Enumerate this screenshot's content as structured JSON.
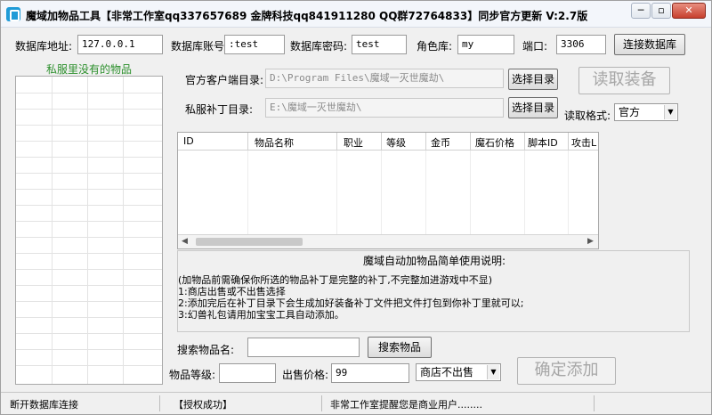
{
  "window": {
    "title": "魔域加物品工具【非常工作室qq337657689 金牌科技qq841911280 QQ群72764833】同步官方更新 V:2.7版",
    "minimize_glyph": "─",
    "restore_glyph": "▫",
    "close_glyph": "✕"
  },
  "db": {
    "addr_label": "数据库地址:",
    "addr_value": "127.0.0.1",
    "user_label": "数据库账号",
    "user_value": ":test",
    "pass_label": "数据库密码:",
    "pass_value": "test",
    "role_label": "角色库:",
    "role_value": "my",
    "port_label": "端口:",
    "port_value": "3306",
    "connect_button": "连接数据库"
  },
  "left_panel": {
    "title": "私服里没有的物品"
  },
  "dirs": {
    "official_label": "官方客户端目录:",
    "official_path": "D:\\Program Files\\魔域一灭世魔劫\\",
    "official_button": "选择目录",
    "private_label": "私服补丁目录:",
    "private_path": "E:\\魔域一灭世魔劫\\",
    "private_button": "选择目录",
    "read_button": "读取装备",
    "format_label": "读取格式:",
    "format_value": "官方"
  },
  "table": {
    "headers": [
      "ID",
      "物品名称",
      "职业",
      "等级",
      "金币",
      "魔石价格",
      "脚本ID",
      "攻击L"
    ],
    "scroll_left": "◀",
    "scroll_right": "▶"
  },
  "help": {
    "title": "魔域自动加物品简单使用说明:",
    "lines": [
      "(加物品前需确保你所选的物品补丁是完整的补丁,不完整加进游戏中不显)",
      "1:商店出售或不出售选择",
      "2:添加完后在补丁目录下会生成加好装备补丁文件把文件打包到你补丁里就可以;",
      "3:幻兽礼包请用加宝宝工具自动添加。"
    ]
  },
  "search": {
    "label": "搜索物品名:",
    "value": "",
    "button": "搜索物品"
  },
  "item": {
    "level_label": "物品等级:",
    "level_value": "",
    "price_label": "出售价格:",
    "price_value": "99",
    "shop_value": "商店不出售",
    "confirm_button": "确定添加"
  },
  "status": {
    "left": "断开数据库连接",
    "middle": "【授权成功】",
    "right": "非常工作室提醒您是商业用户........"
  }
}
